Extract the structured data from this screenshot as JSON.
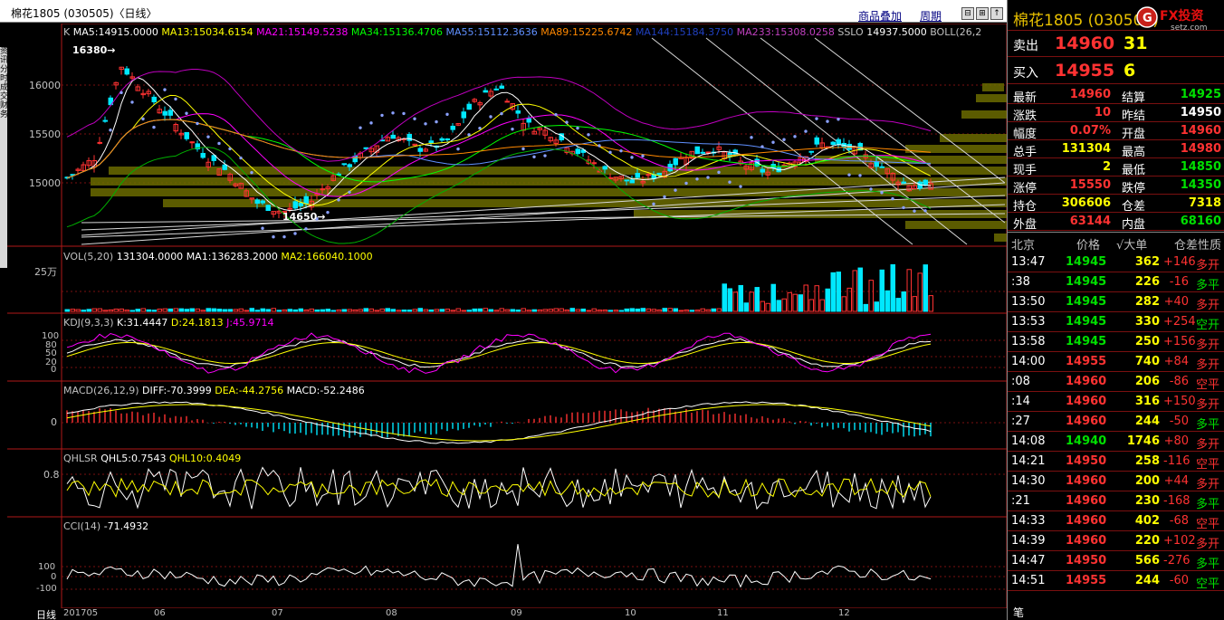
{
  "window": {
    "title": "棉花1805 (030505)〈日线〉",
    "links": [
      "商品叠加",
      "周期"
    ],
    "buttons": [
      "⊟",
      "⊞",
      "↑",
      "↓"
    ]
  },
  "left_strip": [
    "资讯",
    "分时",
    "成交",
    "财务"
  ],
  "main_chart": {
    "legend_prefix": "K",
    "ma": [
      {
        "label": "MA5:14915.0000",
        "color": "#ffffff"
      },
      {
        "label": "MA13:15034.6154",
        "color": "#ffff00"
      },
      {
        "label": "MA21:15149.5238",
        "color": "#ff00ff"
      },
      {
        "label": "MA34:15136.4706",
        "color": "#00ff00"
      },
      {
        "label": "MA55:15112.3636",
        "color": "#6090ff"
      },
      {
        "label": "MA89:15225.6742",
        "color": "#ff8800"
      },
      {
        "label": "MA144:15184.3750",
        "color": "#2040c0"
      },
      {
        "label": "MA233:15308.0258",
        "color": "#c040c0"
      },
      {
        "label": "SSLO",
        "color": "#c0c0c0"
      },
      {
        "label": "14937.5000",
        "color": "#ffffff"
      },
      {
        "label": "BOLL(26,2",
        "color": "#c0c0c0"
      }
    ],
    "y_ticks": [
      "16000",
      "15500",
      "15000"
    ],
    "high_label": "16380→",
    "low_label": "14650→"
  },
  "vol_panel": {
    "legend": [
      {
        "label": "VOL(5,20)",
        "color": "#c0c0c0"
      },
      {
        "label": "131304.0000",
        "color": "#ffffff"
      },
      {
        "label": "MA1:136283.2000",
        "color": "#ffffff"
      },
      {
        "label": "MA2:166040.1000",
        "color": "#ffff00"
      }
    ],
    "y_tick": "25万"
  },
  "kdj_panel": {
    "legend": [
      {
        "label": "KDJ(9,3,3)",
        "color": "#c0c0c0"
      },
      {
        "label": "K:31.4447",
        "color": "#ffffff"
      },
      {
        "label": "D:24.1813",
        "color": "#ffff00"
      },
      {
        "label": "J:45.9714",
        "color": "#ff00ff"
      }
    ],
    "y_ticks": [
      "100",
      "80",
      "50",
      "20",
      "0"
    ]
  },
  "macd_panel": {
    "legend": [
      {
        "label": "MACD(26,12,9)",
        "color": "#c0c0c0"
      },
      {
        "label": "DIFF:-70.3999",
        "color": "#ffffff"
      },
      {
        "label": "DEA:-44.2756",
        "color": "#ffff00"
      },
      {
        "label": "MACD:-52.2486",
        "color": "#ffffff"
      }
    ],
    "y_tick": "0"
  },
  "qhlsr_panel": {
    "legend": [
      {
        "label": "QHLSR",
        "color": "#c0c0c0"
      },
      {
        "label": "QHL5:0.7543",
        "color": "#ffffff"
      },
      {
        "label": "QHL10:0.4049",
        "color": "#ffff00"
      }
    ],
    "y_tick": "0.8"
  },
  "cci_panel": {
    "legend": [
      {
        "label": "CCI(14)",
        "color": "#c0c0c0"
      },
      {
        "label": "-71.4932",
        "color": "#ffffff"
      }
    ],
    "y_ticks": [
      "100",
      "0",
      "-100"
    ]
  },
  "x_axis": {
    "period_label": "日线",
    "labels": [
      "201705",
      "06",
      "07",
      "08",
      "09",
      "10",
      "11",
      "12"
    ]
  },
  "quote_panel": {
    "title": "棉花1805 (030505)",
    "logo_text": "FX投资",
    "logo_sub": "setz.com",
    "sell": {
      "label": "卖出",
      "price": "14960",
      "vol": "31"
    },
    "buy": {
      "label": "买入",
      "price": "14955",
      "vol": "6"
    },
    "rows": [
      [
        {
          "k": "最新",
          "v": "14960",
          "c": "red"
        },
        {
          "k": "结算",
          "v": "14925",
          "c": "green"
        }
      ],
      [
        {
          "k": "涨跌",
          "v": "10",
          "c": "red"
        },
        {
          "k": "昨结",
          "v": "14950",
          "c": "white"
        }
      ],
      [
        {
          "k": "幅度",
          "v": "0.07%",
          "c": "red"
        },
        {
          "k": "开盘",
          "v": "14960",
          "c": "red"
        }
      ],
      [
        {
          "k": "总手",
          "v": "131304",
          "c": "yellow"
        },
        {
          "k": "最高",
          "v": "14980",
          "c": "red"
        }
      ],
      [
        {
          "k": "现手",
          "v": "2",
          "c": "yellow"
        },
        {
          "k": "最低",
          "v": "14850",
          "c": "green"
        }
      ],
      [
        {
          "k": "涨停",
          "v": "15550",
          "c": "red"
        },
        {
          "k": "跌停",
          "v": "14350",
          "c": "green"
        }
      ],
      [
        {
          "k": "持仓",
          "v": "306606",
          "c": "yellow"
        },
        {
          "k": "仓差",
          "v": "7318",
          "c": "yellow"
        }
      ],
      [
        {
          "k": "外盘",
          "v": "63144",
          "c": "red"
        },
        {
          "k": "内盘",
          "v": "68160",
          "c": "green"
        }
      ]
    ],
    "ticks_header": [
      "北京",
      "价格",
      "√大单",
      "仓差",
      "性质"
    ],
    "ticks": [
      {
        "time": "13:47",
        "price": "14945",
        "pc": "green",
        "vol": "362",
        "diff": "+146",
        "kind": "多开",
        "kc": "red"
      },
      {
        "time": ":38",
        "price": "14945",
        "pc": "green",
        "vol": "226",
        "diff": "-16",
        "kind": "多平",
        "kc": "green"
      },
      {
        "time": "13:50",
        "price": "14945",
        "pc": "green",
        "vol": "282",
        "diff": "+40",
        "kind": "多开",
        "kc": "red"
      },
      {
        "time": "13:53",
        "price": "14945",
        "pc": "green",
        "vol": "330",
        "diff": "+254",
        "kind": "空开",
        "kc": "green"
      },
      {
        "time": "13:58",
        "price": "14945",
        "pc": "green",
        "vol": "250",
        "diff": "+156",
        "kind": "多开",
        "kc": "red"
      },
      {
        "time": "14:00",
        "price": "14955",
        "pc": "red",
        "vol": "740",
        "diff": "+84",
        "kind": "多开",
        "kc": "red"
      },
      {
        "time": ":08",
        "price": "14960",
        "pc": "red",
        "vol": "206",
        "diff": "-86",
        "kind": "空平",
        "kc": "red"
      },
      {
        "time": ":14",
        "price": "14960",
        "pc": "red",
        "vol": "316",
        "diff": "+150",
        "kind": "多开",
        "kc": "red"
      },
      {
        "time": ":27",
        "price": "14960",
        "pc": "red",
        "vol": "244",
        "diff": "-50",
        "kind": "多平",
        "kc": "green"
      },
      {
        "time": "14:08",
        "price": "14940",
        "pc": "green",
        "vol": "1746",
        "diff": "+80",
        "kind": "多开",
        "kc": "red"
      },
      {
        "time": "14:21",
        "price": "14950",
        "pc": "red",
        "vol": "258",
        "diff": "-116",
        "kind": "空平",
        "kc": "red"
      },
      {
        "time": "14:30",
        "price": "14960",
        "pc": "red",
        "vol": "200",
        "diff": "+44",
        "kind": "多开",
        "kc": "red"
      },
      {
        "time": ":21",
        "price": "14960",
        "pc": "red",
        "vol": "230",
        "diff": "-168",
        "kind": "多平",
        "kc": "green"
      },
      {
        "time": "14:33",
        "price": "14960",
        "pc": "red",
        "vol": "402",
        "diff": "-68",
        "kind": "空平",
        "kc": "red"
      },
      {
        "time": "14:39",
        "price": "14960",
        "pc": "red",
        "vol": "220",
        "diff": "+102",
        "kind": "多开",
        "kc": "red"
      },
      {
        "time": "14:47",
        "price": "14950",
        "pc": "red",
        "vol": "566",
        "diff": "-276",
        "kind": "多平",
        "kc": "green"
      },
      {
        "time": "14:51",
        "price": "14955",
        "pc": "red",
        "vol": "244",
        "diff": "-60",
        "kind": "空平",
        "kc": "green"
      }
    ],
    "bottom_tab": "笔"
  }
}
